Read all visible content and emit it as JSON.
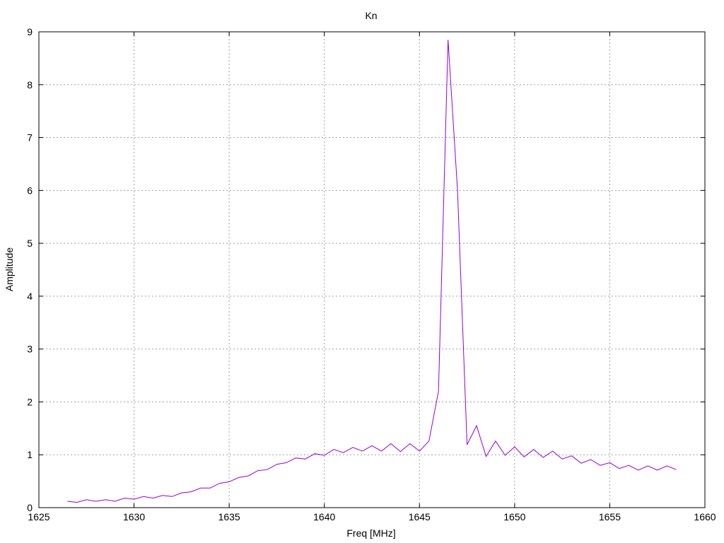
{
  "chart_data": {
    "type": "line",
    "title": "Kn",
    "xlabel": "Freq [MHz]",
    "ylabel": "Amplitude",
    "xlim": [
      1625,
      1660
    ],
    "ylim": [
      0,
      9
    ],
    "xticks": [
      1625,
      1630,
      1635,
      1640,
      1645,
      1650,
      1655,
      1660
    ],
    "yticks": [
      0,
      1,
      2,
      3,
      4,
      5,
      6,
      7,
      8,
      9
    ],
    "grid": true,
    "legend": "none",
    "series": [
      {
        "color": "#9400d3",
        "x": [
          1626.5,
          1627.0,
          1627.5,
          1628.0,
          1628.5,
          1629.0,
          1629.5,
          1630.0,
          1630.5,
          1631.0,
          1631.5,
          1632.0,
          1632.5,
          1633.0,
          1633.5,
          1634.0,
          1634.5,
          1635.0,
          1635.5,
          1636.0,
          1636.5,
          1637.0,
          1637.5,
          1638.0,
          1638.5,
          1639.0,
          1639.5,
          1640.0,
          1640.5,
          1641.0,
          1641.5,
          1642.0,
          1642.5,
          1643.0,
          1643.5,
          1644.0,
          1644.5,
          1645.0,
          1645.5,
          1646.0,
          1646.5,
          1647.0,
          1647.5,
          1648.0,
          1648.5,
          1649.0,
          1649.5,
          1650.0,
          1650.5,
          1651.0,
          1651.5,
          1652.0,
          1652.5,
          1653.0,
          1653.5,
          1654.0,
          1654.5,
          1655.0,
          1655.5,
          1656.0,
          1656.5,
          1657.0,
          1657.5,
          1658.0,
          1658.5
        ],
        "y": [
          0.12,
          0.1,
          0.15,
          0.12,
          0.15,
          0.12,
          0.18,
          0.16,
          0.21,
          0.18,
          0.23,
          0.21,
          0.28,
          0.3,
          0.37,
          0.37,
          0.46,
          0.49,
          0.57,
          0.6,
          0.7,
          0.72,
          0.82,
          0.85,
          0.94,
          0.92,
          1.02,
          0.99,
          1.1,
          1.04,
          1.14,
          1.07,
          1.17,
          1.07,
          1.21,
          1.06,
          1.21,
          1.07,
          1.26,
          2.2,
          8.85,
          6.0,
          1.19,
          1.55,
          0.97,
          1.26,
          0.99,
          1.15,
          0.96,
          1.1,
          0.95,
          1.07,
          0.92,
          0.98,
          0.84,
          0.91,
          0.8,
          0.85,
          0.74,
          0.8,
          0.71,
          0.79,
          0.71,
          0.79,
          0.72
        ]
      }
    ]
  }
}
